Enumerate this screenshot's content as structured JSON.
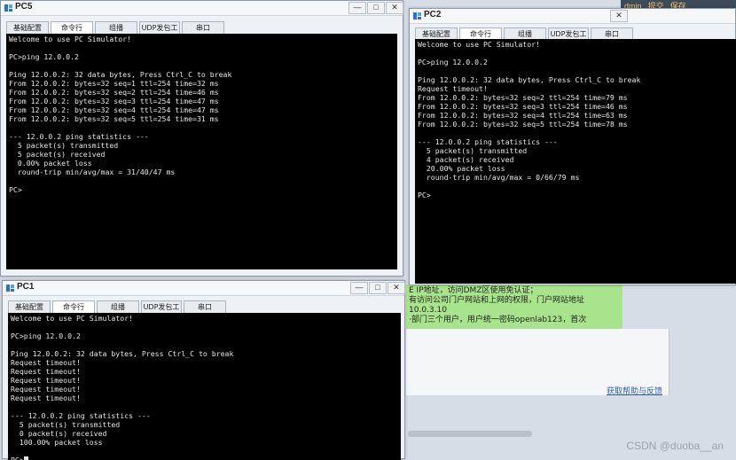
{
  "background": {
    "topbar_items": [
      "dmin",
      "提交",
      "保存"
    ],
    "green_note": [
      "E IP地址，访问DMZ区使用免认证；",
      "有访问公司门户网站和上网的权限，门户网站地址10.0.3.10",
      "·部门三个用户，用户统一密码openlab123，首次"
    ],
    "help_link": "获取帮助与反馈",
    "watermark": "CSDN @duoba__an"
  },
  "tab_labels": [
    "基础配置",
    "命令行",
    "组播",
    "UDP发包工具",
    "串口"
  ],
  "window_buttons": {
    "minimize": "—",
    "maximize": "□",
    "close": "✕"
  },
  "windows": {
    "pc5": {
      "title": "PC5",
      "lines": [
        "Welcome to use PC Simulator!",
        "",
        "PC>ping 12.0.0.2",
        "",
        "Ping 12.0.0.2: 32 data bytes, Press Ctrl_C to break",
        "From 12.0.0.2: bytes=32 seq=1 ttl=254 time=32 ms",
        "From 12.0.0.2: bytes=32 seq=2 ttl=254 time=46 ms",
        "From 12.0.0.2: bytes=32 seq=3 ttl=254 time=47 ms",
        "From 12.0.0.2: bytes=32 seq=4 ttl=254 time=47 ms",
        "From 12.0.0.2: bytes=32 seq=5 ttl=254 time=31 ms",
        "",
        "--- 12.0.0.2 ping statistics ---",
        "  5 packet(s) transmitted",
        "  5 packet(s) received",
        "  0.00% packet loss",
        "  round-trip min/avg/max = 31/40/47 ms",
        "",
        "PC>"
      ]
    },
    "pc2": {
      "title": "PC2",
      "lines": [
        "Welcome to use PC Simulator!",
        "",
        "PC>ping 12.0.0.2",
        "",
        "Ping 12.0.0.2: 32 data bytes, Press Ctrl_C to break",
        "Request timeout!",
        "From 12.0.0.2: bytes=32 seq=2 ttl=254 time=79 ms",
        "From 12.0.0.2: bytes=32 seq=3 ttl=254 time=46 ms",
        "From 12.0.0.2: bytes=32 seq=4 ttl=254 time=63 ms",
        "From 12.0.0.2: bytes=32 seq=5 ttl=254 time=78 ms",
        "",
        "--- 12.0.0.2 ping statistics ---",
        "  5 packet(s) transmitted",
        "  4 packet(s) received",
        "  20.00% packet loss",
        "  round-trip min/avg/max = 0/66/79 ms",
        "",
        "PC>"
      ]
    },
    "pc1": {
      "title": "PC1",
      "lines": [
        "Welcome to use PC Simulator!",
        "",
        "PC>ping 12.0.0.2",
        "",
        "Ping 12.0.0.2: 32 data bytes, Press Ctrl_C to break",
        "Request timeout!",
        "Request timeout!",
        "Request timeout!",
        "Request timeout!",
        "Request timeout!",
        "",
        "--- 12.0.0.2 ping statistics ---",
        "  5 packet(s) transmitted",
        "  0 packet(s) received",
        "  100.00% packet loss",
        "",
        "PC>"
      ]
    }
  }
}
